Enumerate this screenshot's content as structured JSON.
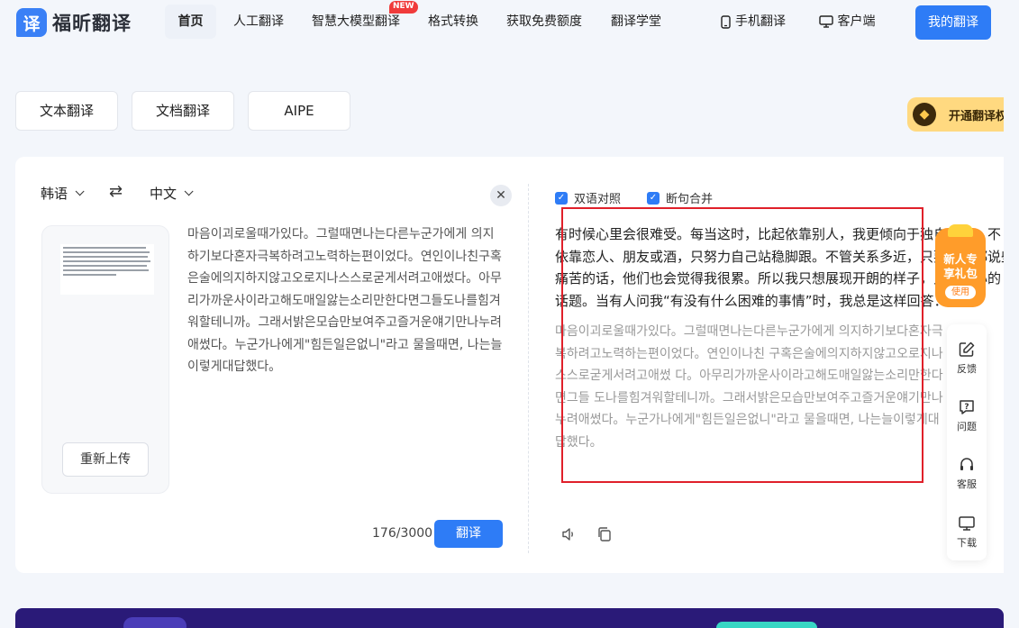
{
  "brand": {
    "logo_char": "译",
    "name": "福昕翻译"
  },
  "nav": {
    "items": [
      "首页",
      "人工翻译",
      "智慧大模型翻译",
      "格式转换",
      "获取免费额度",
      "翻译学堂"
    ],
    "new_badge": "NEW",
    "mobile": "手机翻译",
    "client": "客户端",
    "my_translation": "我的翻译"
  },
  "modes": [
    "文本翻译",
    "文档翻译",
    "AIPE"
  ],
  "vip": {
    "label": "开通翻译权"
  },
  "source": {
    "lang": "韩语",
    "target_lang": "中文",
    "reupload": "重新上传",
    "text": "마음이괴로울때가있다。그럴때면나는다른누군가에게 의지하기보다혼자극복하려고노력하는편이었다。연인이나친구혹은술에의지하지않고오로지나스스로굳게서려고애썼다。아무리가까운사이라고해도매일앓는소리만한다면그들도나를힘겨워할테니까。그래서밝은모습만보여주고즐거운얘기만나누려애썼다。누군가나에게\"힘든일은없니\"라고 물을때면, 나는늘이렇게대답했다。",
    "counter": "176/3000",
    "translate": "翻译"
  },
  "target": {
    "opt_bilingual": "双语对照",
    "opt_merge": "断句合并",
    "zh_lines": [
      "有时候心里会很难受。每当这时，比起依靠别人，我更倾向于独自克服。不",
      "依靠恋人、朋友或酒，只努力自己站稳脚跟。不管关系多近，只要每天都说些",
      "痛苦的话，他们也会觉得我很累。所以我只想展现开朗的样子，只聊开心的",
      "话题。当有人问我“有没有什么困难的事情”时，我总是这样回答："
    ],
    "ko_lines": [
      "마음이괴로울때가있다。그럴때면나는다른누군가에게 의지하기보다혼자극",
      "복하려고노력하는편이었다。연인이나친 구혹은술에의지하지않고오로지나",
      "스스로굳게서려고애썼 다。아무리가까운사이라고해도매일앓는소리만한다",
      "면그들 도나를힘겨워할테니까。그래서밝은모습만보여주고즐거운얘기만나",
      "누려애썼다。누군가나에게\"힘든일은없니\"라고 물을때면, 나는늘이렇게대",
      "답했다。"
    ]
  },
  "float": {
    "gift_line1": "新人专",
    "gift_line2": "享礼包",
    "gift_use": "使用",
    "feedback": "反馈",
    "question": "问题",
    "service": "客服",
    "download": "下载"
  },
  "colors": {
    "accent": "#2e7cf6",
    "highlight_box": "#e0202a",
    "gift": "#ff9c2a"
  }
}
